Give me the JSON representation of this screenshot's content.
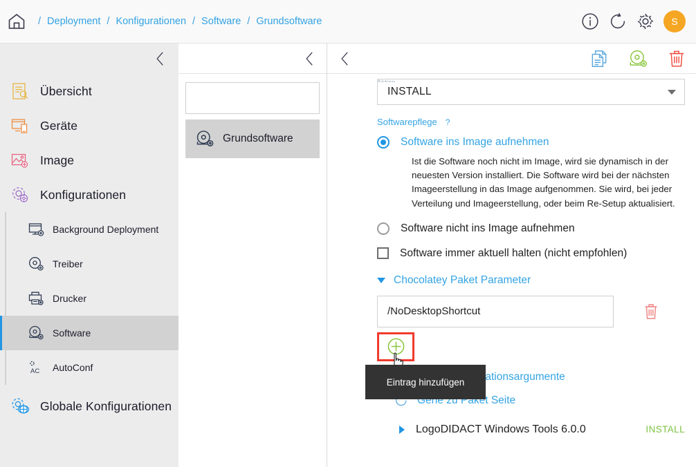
{
  "topbar": {
    "home_icon": "home-icon",
    "breadcrumbs": [
      {
        "label": "Deployment"
      },
      {
        "label": "Konfigurationen"
      },
      {
        "label": "Software"
      },
      {
        "label": "Grundsoftware"
      }
    ],
    "separator": "/",
    "actions": [
      {
        "name": "info-icon",
        "label": "Info"
      },
      {
        "name": "refresh-icon",
        "label": "Aktualisieren"
      },
      {
        "name": "gear-icon",
        "label": "Einstellungen"
      }
    ],
    "avatar_initial": "S",
    "avatar_color": "#f5a623"
  },
  "sidebar": {
    "collapse_icon": "chevron-left-icon",
    "items": [
      {
        "label": "Übersicht",
        "icon": "overview-icon",
        "color": "#e8b33c"
      },
      {
        "label": "Geräte",
        "icon": "devices-icon",
        "color": "#ef8b3c"
      },
      {
        "label": "Image",
        "icon": "image-icon",
        "color": "#e8607e"
      },
      {
        "label": "Konfigurationen",
        "icon": "configurations-icon",
        "color": "#9b6cc4"
      }
    ],
    "subitems": [
      {
        "label": "Background Deployment",
        "icon": "background-deployment-icon",
        "active": false
      },
      {
        "label": "Treiber",
        "icon": "driver-icon",
        "active": false
      },
      {
        "label": "Drucker",
        "icon": "printer-icon",
        "active": false
      },
      {
        "label": "Software",
        "icon": "software-disc-icon",
        "active": true
      },
      {
        "label": "AutoConf",
        "icon": "autoconf-icon",
        "active": false
      }
    ],
    "global": {
      "label": "Globale Konfigurationen",
      "icon": "global-config-icon",
      "color": "#2196e3"
    },
    "active_color": "#2196e3",
    "active_bg": "#d2d2d2"
  },
  "midpanel": {
    "collapse_icon": "chevron-left-icon",
    "search": {
      "value": "",
      "placeholder": "",
      "icon": "search-icon"
    },
    "items": [
      {
        "label": "Grundsoftware",
        "icon": "software-disc-icon",
        "selected": true
      }
    ]
  },
  "main": {
    "back_icon": "chevron-left-icon",
    "toolbar_actions": [
      {
        "name": "copy-document-icon",
        "label": "Kopieren",
        "color": "#5aa9dd"
      },
      {
        "name": "software-disc-icon",
        "label": "Software",
        "color": "#8cc63f"
      },
      {
        "name": "delete-trash-icon",
        "label": "Löschen",
        "color": "#ef4b3f"
      }
    ],
    "action_select": {
      "value": "INSTALL",
      "label": "Aktion"
    },
    "section": {
      "title": "Softwarepflege",
      "help": "?"
    },
    "options": [
      {
        "type": "radio",
        "label": "Software ins Image aufnehmen",
        "checked": true,
        "highlight": true
      },
      {
        "type": "radio",
        "label": "Software nicht ins Image aufnehmen",
        "checked": false,
        "highlight": false
      },
      {
        "type": "checkbox",
        "label": "Software immer aktuell halten (nicht empfohlen)",
        "checked": false,
        "highlight": false
      }
    ],
    "description": "Ist die Software noch nicht im Image, wird sie dynamisch in der neuesten Version installiert. Die Software wird bei der nächsten Imageerstellung in das Image aufgenommen. Sie wird, bei jeder Verteilung und Imageerstellung, oder beim Re-Setup aktualisiert.",
    "chocolatey_params": {
      "title": "Chocolatey Paket Parameter",
      "expanded": true,
      "entries": [
        {
          "value": "/NoDesktopShortcut",
          "delete_icon": "delete-trash-icon"
        }
      ],
      "add_button": {
        "icon": "plus-circle-icon",
        "tooltip": "Eintrag hinzufügen",
        "highlighted": true
      }
    },
    "chocolatey_install_args": {
      "title": "Chocolatey Installationsargumente",
      "expanded": false
    },
    "package_page_link": {
      "label": "Gehe zu Paket Seite",
      "icon": "external-link-icon"
    },
    "package": {
      "name": "LogoDIDACT Windows Tools 6.0.0",
      "state": "INSTALL",
      "state_color": "#7dc242",
      "expand_icon": "triangle-right-icon"
    }
  }
}
